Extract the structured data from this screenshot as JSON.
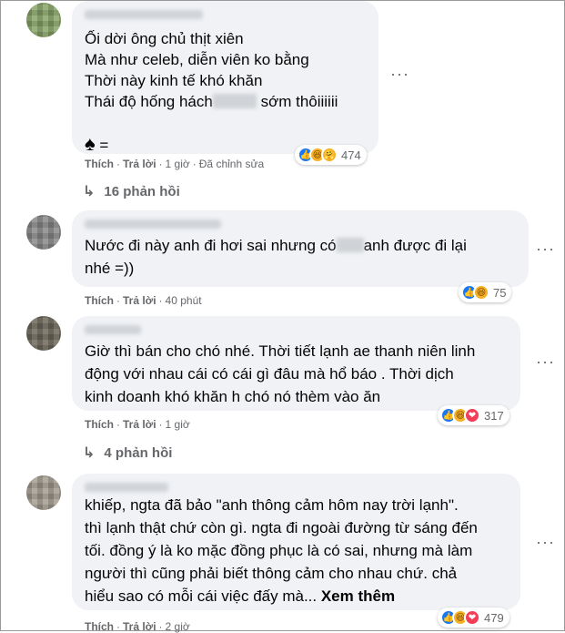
{
  "comments": [
    {
      "text_lines": [
        "Ối dời ông chủ thịt xiên",
        "Mà như celeb, diễn viên ko bằng",
        "Thời này kinh tế khó khăn"
      ],
      "text_line4_a": "Thái độ hống hách",
      "text_line4_b": " sớm thôiiiiii",
      "emoji_line_symbol": "♠",
      "emoji_line_suffix": " =",
      "like_label": "Thích",
      "reply_label": "Trả lời",
      "time": "1 giờ",
      "edited": "Đã chỉnh sửa",
      "reaction_count": "474",
      "reactions": [
        "like",
        "haha",
        "care"
      ],
      "replies_label": "16 phản hồi"
    },
    {
      "text_a": "Nước đi này anh đi hơi sai nhưng có",
      "text_b": "anh được đi lại",
      "text_c": "nhé =))",
      "like_label": "Thích",
      "reply_label": "Trả lời",
      "time": "40 phút",
      "reaction_count": "75",
      "reactions": [
        "like",
        "haha"
      ]
    },
    {
      "text": "Giờ thì bán cho chó nhé. Thời tiết lạnh ae thanh niên linh\nđộng với nhau cái có cái gì đâu mà hổ báo . Thời dịch\nkinh doanh khó khăn h chó nó thèm vào ăn",
      "like_label": "Thích",
      "reply_label": "Trả lời",
      "time": "1 giờ",
      "reaction_count": "317",
      "reactions": [
        "like",
        "haha",
        "love"
      ],
      "replies_label": "4 phản hồi"
    },
    {
      "text": "khiếp, ngta đã bảo \"anh thông cảm hôm nay trời lạnh\".\nthì lạnh thật chứ còn gì. ngta đi ngoài đường từ sáng đến\ntối. đồng ý là ko mặc đồng phục là có sai, nhưng mà làm\nngười thì cũng phải biết thông cảm cho nhau chứ. chả\nhiểu sao có mỗi cái việc đấy mà... ",
      "see_more": "Xem thêm",
      "like_label": "Thích",
      "reply_label": "Trả lời",
      "time": "2 giờ",
      "reaction_count": "479",
      "reactions": [
        "like",
        "haha",
        "love"
      ]
    }
  ],
  "more_glyph": "···",
  "dot": "·",
  "reply_arrow": "↳",
  "colors": {
    "bubble": "#f0f2f5",
    "secondary_text": "#65676b",
    "like": "#1877f2",
    "haha": "#f7b125",
    "love": "#f33e58"
  }
}
